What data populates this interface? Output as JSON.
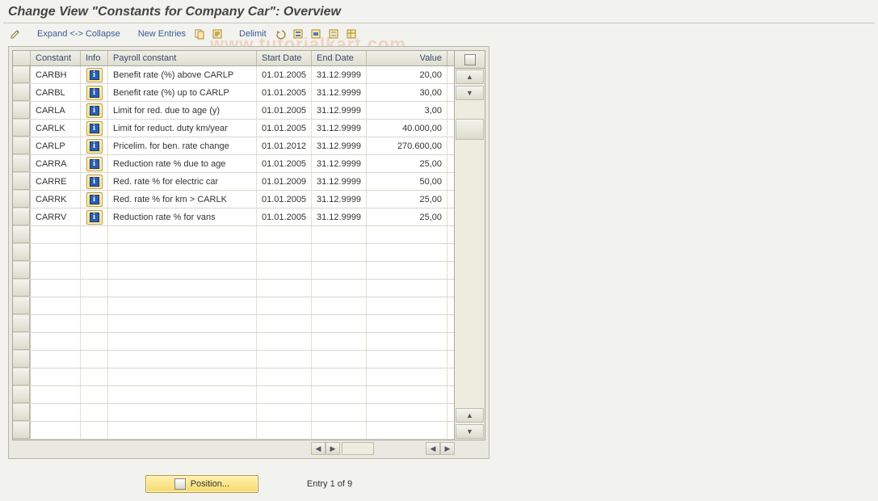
{
  "title": "Change View \"Constants for Company Car\": Overview",
  "watermark": "www.tutorialkart.com",
  "toolbar": {
    "pencil_icon": "pencil-icon",
    "expand_collapse": "Expand <-> Collapse",
    "new_entries": "New Entries",
    "copy_icon": "copy-icon",
    "var_icon": "variant-icon",
    "delimit": "Delimit",
    "undo_icon": "undo-icon",
    "select_all_icon": "select-all-icon",
    "select_block_icon": "select-block-icon",
    "deselect_all_icon": "deselect-all-icon",
    "config_icon": "table-settings-icon"
  },
  "grid": {
    "headers": {
      "constant": "Constant",
      "info": "Info",
      "payroll_constant": "Payroll constant",
      "start_date": "Start Date",
      "end_date": "End Date",
      "value": "Value"
    },
    "rows": [
      {
        "constant": "CARBH",
        "desc": "Benefit rate (%) above CARLP",
        "start": "01.01.2005",
        "end": "31.12.9999",
        "value": "20,00"
      },
      {
        "constant": "CARBL",
        "desc": "Benefit rate (%) up to CARLP",
        "start": "01.01.2005",
        "end": "31.12.9999",
        "value": "30,00"
      },
      {
        "constant": "CARLA",
        "desc": "Limit for red. due to age (y)",
        "start": "01.01.2005",
        "end": "31.12.9999",
        "value": "3,00"
      },
      {
        "constant": "CARLK",
        "desc": "Limit for reduct. duty km/year",
        "start": "01.01.2005",
        "end": "31.12.9999",
        "value": "40.000,00"
      },
      {
        "constant": "CARLP",
        "desc": "Pricelim. for ben. rate change",
        "start": "01.01.2012",
        "end": "31.12.9999",
        "value": "270.600,00"
      },
      {
        "constant": "CARRA",
        "desc": "Reduction rate % due to age",
        "start": "01.01.2005",
        "end": "31.12.9999",
        "value": "25,00"
      },
      {
        "constant": "CARRE",
        "desc": "Red. rate % for electric car",
        "start": "01.01.2009",
        "end": "31.12.9999",
        "value": "50,00"
      },
      {
        "constant": "CARRK",
        "desc": "Red. rate % for km > CARLK",
        "start": "01.01.2005",
        "end": "31.12.9999",
        "value": "25,00"
      },
      {
        "constant": "CARRV",
        "desc": "Reduction rate % for vans",
        "start": "01.01.2005",
        "end": "31.12.9999",
        "value": "25,00"
      }
    ],
    "blank_rows": 12
  },
  "footer": {
    "position_label": "Position...",
    "entry_text": "Entry 1 of 9"
  }
}
